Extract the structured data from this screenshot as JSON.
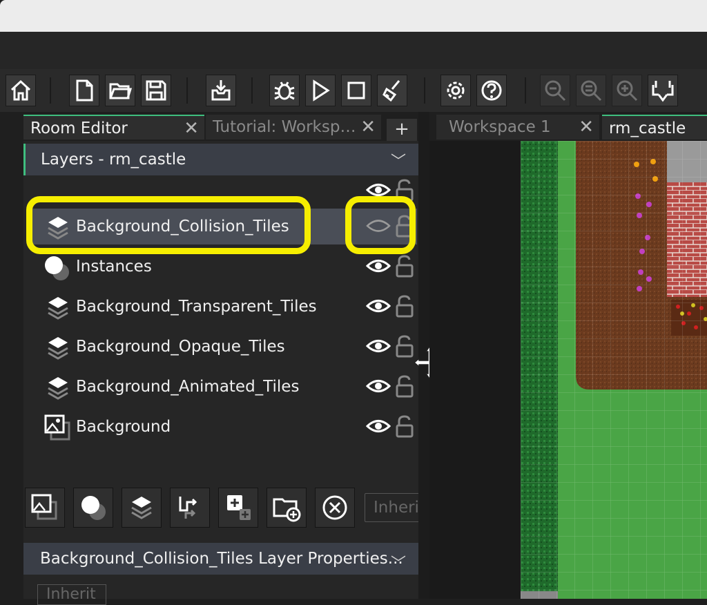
{
  "left_tabs": [
    {
      "label": "Room Editor",
      "active": true
    },
    {
      "label": "Tutorial: Worksp…",
      "active": false
    }
  ],
  "add_tab_label": "+",
  "right_tabs": [
    {
      "label": "Workspace 1",
      "active": false
    },
    {
      "label": "rm_castle",
      "active": true
    }
  ],
  "layers_panel": {
    "title": "Layers - rm_castle",
    "layers": [
      {
        "name": "Background_Collision_Tiles",
        "type": "tile",
        "visible": false,
        "selected": true
      },
      {
        "name": "Instances",
        "type": "instance",
        "visible": true,
        "selected": false
      },
      {
        "name": "Background_Transparent_Tiles",
        "type": "tile",
        "visible": true,
        "selected": false
      },
      {
        "name": "Background_Opaque_Tiles",
        "type": "tile",
        "visible": true,
        "selected": false
      },
      {
        "name": "Background_Animated_Tiles",
        "type": "tile",
        "visible": true,
        "selected": false
      },
      {
        "name": "Background",
        "type": "background",
        "visible": true,
        "selected": false
      }
    ],
    "inherit_button": "Inheri"
  },
  "properties_panel": {
    "title": "Background_Collision_Tiles Layer Properties...",
    "inherit_button": "Inherit"
  },
  "colors": {
    "highlight": "#f6ee00",
    "accent": "#3fbf7f"
  },
  "toolbar_icons": [
    "home-icon",
    "new-file-icon",
    "open-folder-icon",
    "save-icon",
    "export-icon",
    "debug-icon",
    "run-icon",
    "stop-icon",
    "clean-icon",
    "settings-icon",
    "help-icon",
    "zoom-out-icon",
    "zoom-reset-icon",
    "zoom-in-icon",
    "game-frame-icon"
  ]
}
